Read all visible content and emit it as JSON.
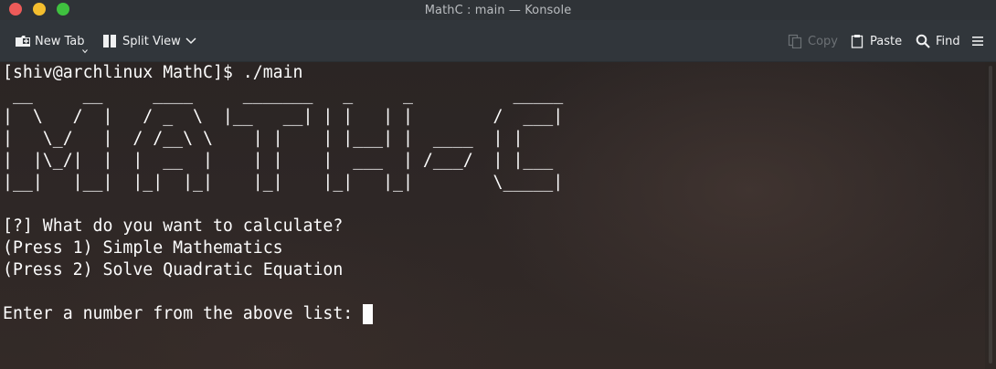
{
  "window": {
    "title": "MathC : main — Konsole"
  },
  "toolbar": {
    "new_tab_label": "New Tab",
    "split_view_label": "Split View",
    "copy_label": "Copy",
    "paste_label": "Paste",
    "find_label": "Find"
  },
  "icons": {
    "new_tab": "new-tab-icon",
    "split_view": "split-view-icon",
    "copy": "copy-icon",
    "paste": "paste-icon",
    "find": "search-icon",
    "menu": "hamburger-menu-icon"
  },
  "colors": {
    "close": "#ee5b59",
    "minimize": "#f4be2e",
    "maximize": "#3fc13f",
    "terminal_text": "#fcfcfc",
    "toolbar_bg": "#31363b"
  },
  "terminal": {
    "prompt_line": "[shiv@archlinux MathC]$ ./main",
    "ascii_art": [
      " __     __     ____     _______   _     _          _____",
      "|  \\   /  |   / _  \\  |__   __| | |   | |        /  ___|",
      "|   \\_/   |  / /__\\ \\    | |    | |___| |  ____  | |",
      "|  |\\_/|  |  |  __  |    | |    |  ___  | /___/  | |___",
      "|__|   |__|  |_|  |_|    |_|    |_|   |_|        \\_____|"
    ],
    "blank_1": "",
    "question": "[?] What do you want to calculate?",
    "option_1": "(Press 1) Simple Mathematics",
    "option_2": "(Press 2) Solve Quadratic Equation",
    "blank_2": "",
    "input_prompt": "Enter a number from the above list: "
  }
}
